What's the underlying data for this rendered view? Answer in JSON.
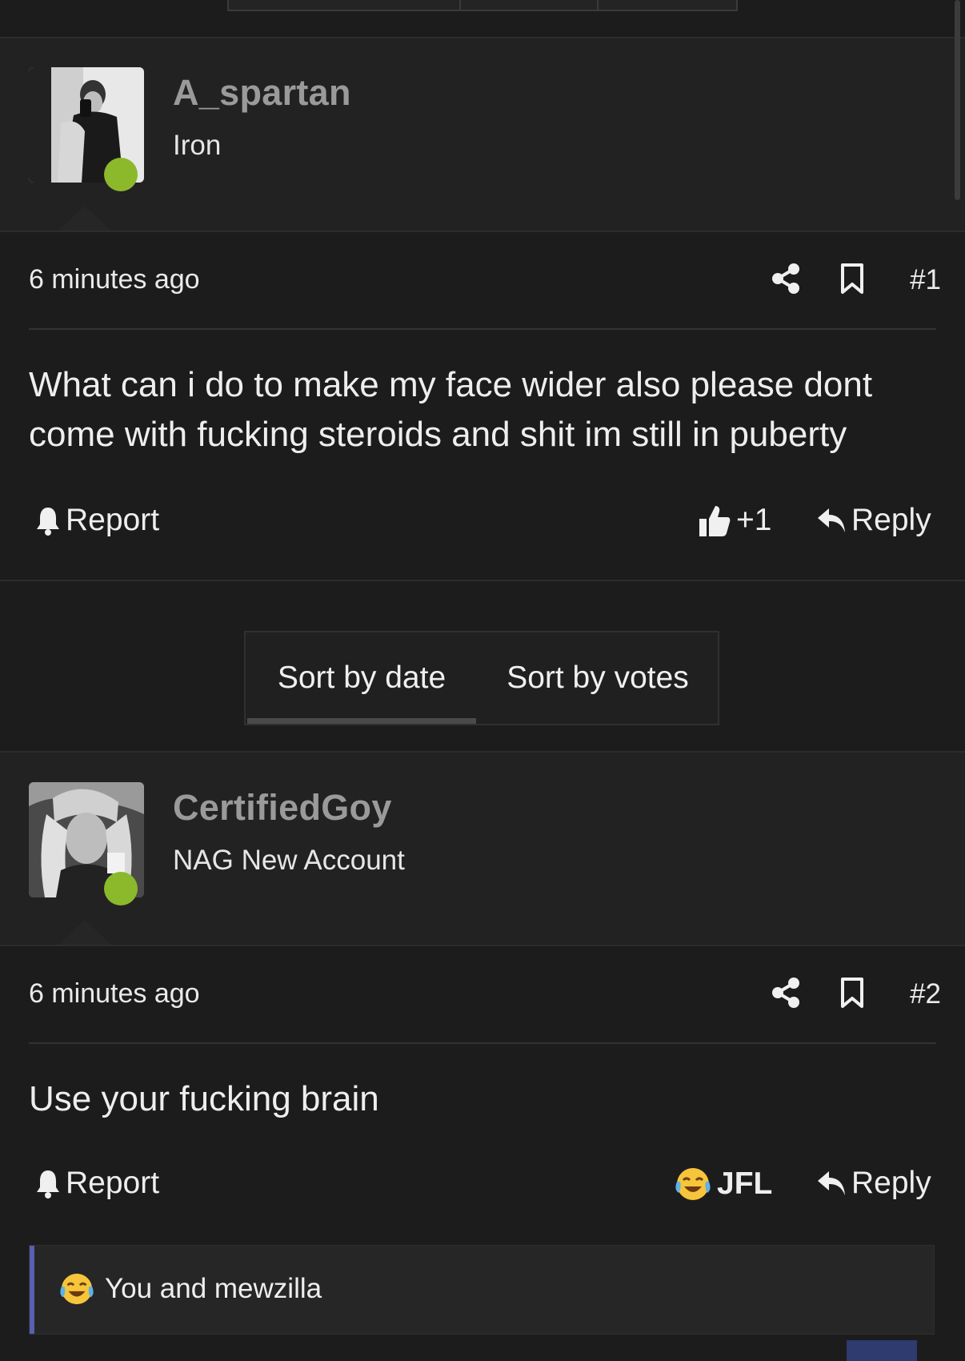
{
  "posts": [
    {
      "author": "A_spartan",
      "rank": "Iron",
      "time": "6 minutes ago",
      "number": "#1",
      "body": "What can i do to make my face wider also please dont come with fucking steroids and shit im still in puberty",
      "report_label": "Report",
      "reaction_label": "+1",
      "reply_label": "Reply"
    },
    {
      "author": "CertifiedGoy",
      "rank": "NAG New Account",
      "time": "6 minutes ago",
      "number": "#2",
      "body": "Use your fucking brain",
      "report_label": "Report",
      "reaction_label": "JFL",
      "reply_label": "Reply",
      "reaction_summary": "You and mewzilla"
    }
  ],
  "sort": {
    "by_date": "Sort by date",
    "by_votes": "Sort by votes",
    "active": "by_date"
  },
  "colors": {
    "online": "#8cb82b",
    "quote_accent": "#5a5fb0"
  }
}
